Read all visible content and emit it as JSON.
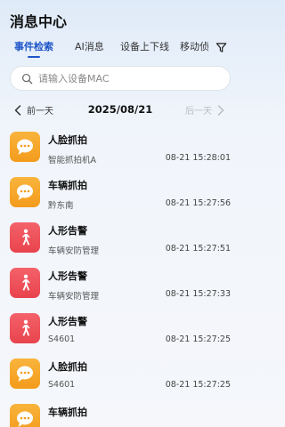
{
  "header": {
    "title": "消息中心"
  },
  "tabs": [
    {
      "label": "事件检索",
      "active": true
    },
    {
      "label": "AI消息",
      "active": false
    },
    {
      "label": "设备上下线",
      "active": false
    },
    {
      "label": "移动侦",
      "active": false
    }
  ],
  "filter_icon": "filter-icon",
  "search": {
    "placeholder": "请输入设备MAC",
    "value": ""
  },
  "datebar": {
    "prev_label": "前一天",
    "date": "2025/08/21",
    "next_label": "后一天"
  },
  "colors": {
    "accent": "#1e55c8",
    "orange_icon": "#f5a524",
    "red_icon": "#ec4a53"
  },
  "events": [
    {
      "title": "人脸抓拍",
      "sub": "智能抓拍机A",
      "time": "08-21 15:28:01",
      "icon": "message-icon",
      "color": "orange"
    },
    {
      "title": "车辆抓拍",
      "sub": "黔东南",
      "time": "08-21 15:27:56",
      "icon": "message-icon",
      "color": "orange"
    },
    {
      "title": "人形告警",
      "sub": "车辆安防管理",
      "time": "08-21 15:27:51",
      "icon": "person-walking-icon",
      "color": "red"
    },
    {
      "title": "人形告警",
      "sub": "车辆安防管理",
      "time": "08-21 15:27:33",
      "icon": "person-walking-icon",
      "color": "red"
    },
    {
      "title": "人形告警",
      "sub": "S4601",
      "time": "08-21 15:27:25",
      "icon": "person-walking-icon",
      "color": "red"
    },
    {
      "title": "人脸抓拍",
      "sub": "S4601",
      "time": "08-21 15:27:25",
      "icon": "message-icon",
      "color": "orange"
    },
    {
      "title": "车辆抓拍",
      "sub": "",
      "time": "",
      "icon": "message-icon",
      "color": "orange"
    }
  ]
}
